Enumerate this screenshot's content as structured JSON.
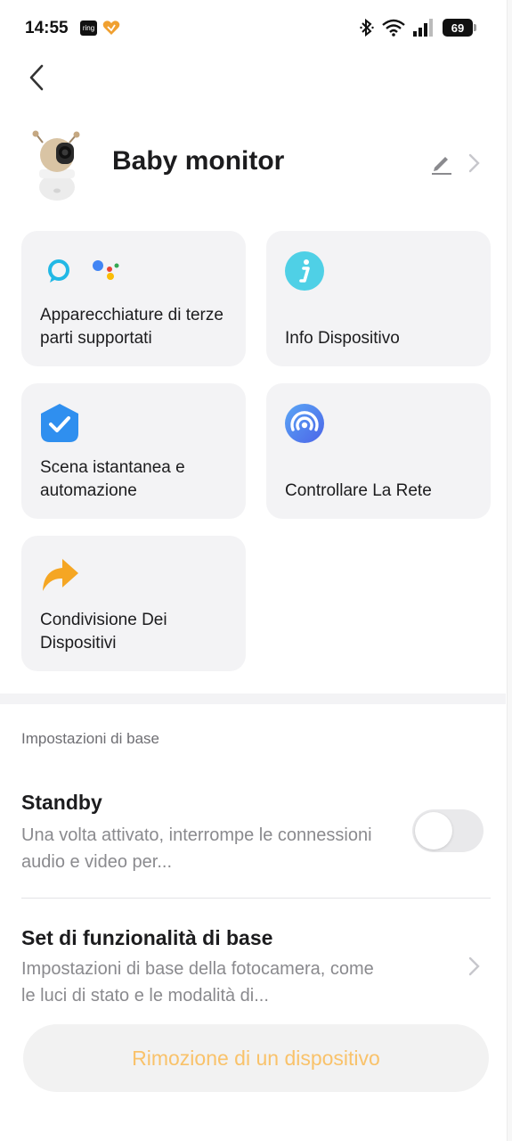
{
  "status_bar": {
    "time": "14:55",
    "ring_label": "ring",
    "battery": "69"
  },
  "device": {
    "name": "Baby monitor"
  },
  "cards": [
    {
      "label": "Apparecchiature di terze parti supportati",
      "icon": "alexa-google-assistant-icon"
    },
    {
      "label": "Info Dispositivo",
      "icon": "info-icon"
    },
    {
      "label": "Scena istantanea e automazione",
      "icon": "automation-shield-check-icon"
    },
    {
      "label": "Controllare La Rete",
      "icon": "network-signal-icon"
    },
    {
      "label": "Condivisione Dei Dispositivi",
      "icon": "share-arrow-icon"
    }
  ],
  "basic_settings": {
    "section_title": "Impostazioni di base",
    "standby": {
      "title": "Standby",
      "description": "Una volta attivato, interrompe le connessioni audio e video per...",
      "enabled": false
    },
    "feature_set": {
      "title": "Set di funzionalità di base",
      "description": "Impostazioni di base della fotocamera, come le luci di stato e le modalità di..."
    }
  },
  "remove_button": {
    "label": "Rimozione di un dispositivo"
  },
  "colors": {
    "accent_orange": "#f9c26a",
    "card_bg": "#f3f3f5",
    "info_cyan": "#4fd0e6",
    "automation_blue": "#2f8fef",
    "network_blue": "#4c7df0"
  }
}
